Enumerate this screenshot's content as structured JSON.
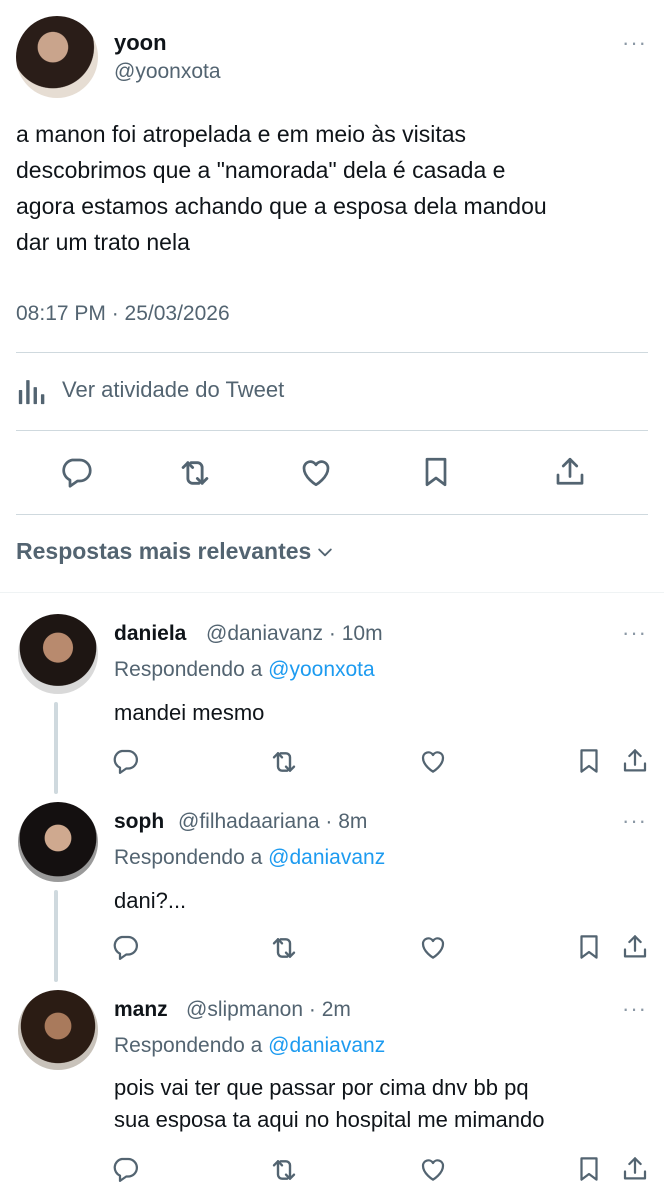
{
  "tweet": {
    "author_name": "yoon",
    "author_handle": "@yoonxota",
    "text_lines": [
      "a manon foi atropelada e em meio às visitas",
      "descobrimos que a \"namorada\" dela é casada e",
      "agora estamos achando que a esposa dela mandou",
      "dar um trato nela"
    ],
    "timestamp": "08:17 PM · 25/03/2026",
    "activity_label": "Ver atividade do Tweet"
  },
  "replies_header": "Respostas mais relevantes",
  "replies": [
    {
      "name": "daniela",
      "meta": "@daniavanz · 10m",
      "replying_prefix": "Respondendo a",
      "replying_to": "@yoonxota",
      "text_lines": [
        "mandei mesmo"
      ]
    },
    {
      "name": "soph",
      "meta": "@filhadaariana · 8m",
      "replying_prefix": "Respondendo a",
      "replying_to": "@daniavanz",
      "text_lines": [
        "dani?..."
      ]
    },
    {
      "name": "manz",
      "meta": "@slipmanon · 2m",
      "replying_prefix": "Respondendo a",
      "replying_to": "@daniavanz",
      "text_lines": [
        "pois vai ter que passar por cima dnv bb pq",
        "sua esposa ta aqui no hospital me mimando"
      ]
    }
  ],
  "colors": {
    "accent": "#1d9bf0",
    "text": "#0f1419",
    "secondary": "#536471",
    "divider": "#cfd9de"
  },
  "icons": [
    "more-icon",
    "stats-icon",
    "reply-icon",
    "retweet-icon",
    "like-icon",
    "bookmark-icon",
    "share-icon",
    "chevron-down-icon"
  ]
}
